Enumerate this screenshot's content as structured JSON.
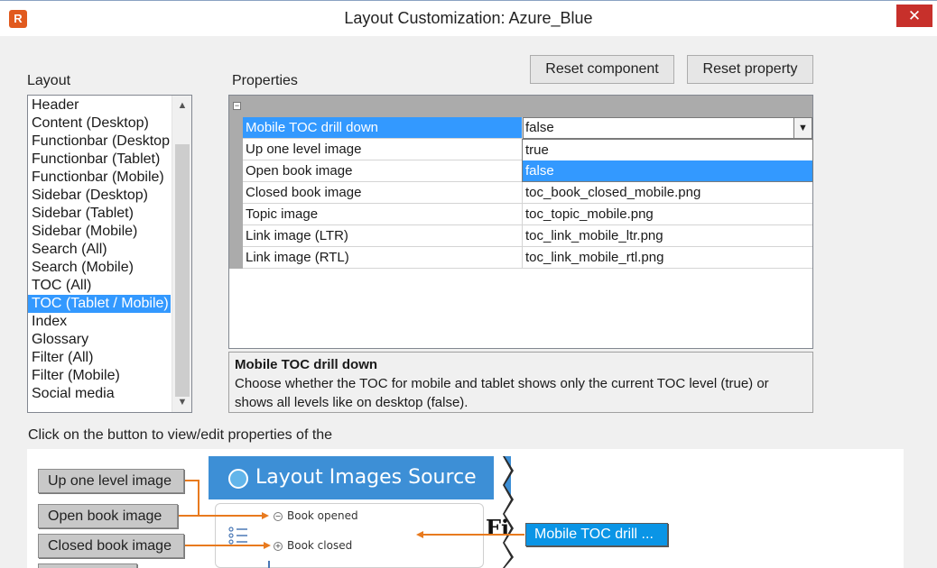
{
  "window": {
    "app_icon": "R",
    "title": "Layout Customization: Azure_Blue",
    "close_icon": "close-icon"
  },
  "labels": {
    "layout": "Layout",
    "properties": "Properties",
    "preview_hint": "Click on the button to view/edit properties of the"
  },
  "buttons": {
    "reset_component": "Reset component",
    "reset_property": "Reset property"
  },
  "layout_list": {
    "items": [
      "Header",
      "Content (Desktop)",
      "Functionbar (Desktop",
      "Functionbar (Tablet)",
      "Functionbar (Mobile)",
      "Sidebar (Desktop)",
      "Sidebar (Tablet)",
      "Sidebar (Mobile)",
      "Search (All)",
      "Search (Mobile)",
      "TOC (All)",
      "TOC (Tablet / Mobile)",
      "Index",
      "Glossary",
      "Filter (All)",
      "Filter (Mobile)",
      "Social media"
    ],
    "selected": "TOC (Tablet / Mobile)"
  },
  "properties": {
    "rows": [
      {
        "name": "Mobile TOC drill down",
        "value": "false"
      },
      {
        "name": "Up one level image",
        "value": ""
      },
      {
        "name": "Open book image",
        "value": ""
      },
      {
        "name": "Closed book image",
        "value": "toc_book_closed_mobile.png"
      },
      {
        "name": "Topic image",
        "value": "toc_topic_mobile.png"
      },
      {
        "name": "Link image (LTR)",
        "value": "toc_link_mobile_ltr.png"
      },
      {
        "name": "Link image (RTL)",
        "value": "toc_link_mobile_rtl.png"
      }
    ],
    "selected_row": "Mobile TOC drill down",
    "dropdown_options": [
      "true",
      "false"
    ],
    "dropdown_selected": "false"
  },
  "description": {
    "title": "Mobile TOC drill down",
    "text": "Choose whether the TOC for mobile and tablet shows only the current TOC level (true) or shows all levels like on desktop (false)."
  },
  "preview": {
    "component_buttons": [
      "Up one level image",
      "Open book image",
      "Closed book image"
    ],
    "banner_title": "Layout Images Source",
    "tree_items": [
      "Book opened",
      "Book closed"
    ],
    "partial_heading": "Fi",
    "highlight_button": "Mobile TOC drill ..."
  },
  "colors": {
    "selection": "#3399ff",
    "close_button": "#c7302b",
    "banner": "#3d8fd6",
    "connector": "#e87a1e",
    "highlight_button": "#0a95e6"
  }
}
